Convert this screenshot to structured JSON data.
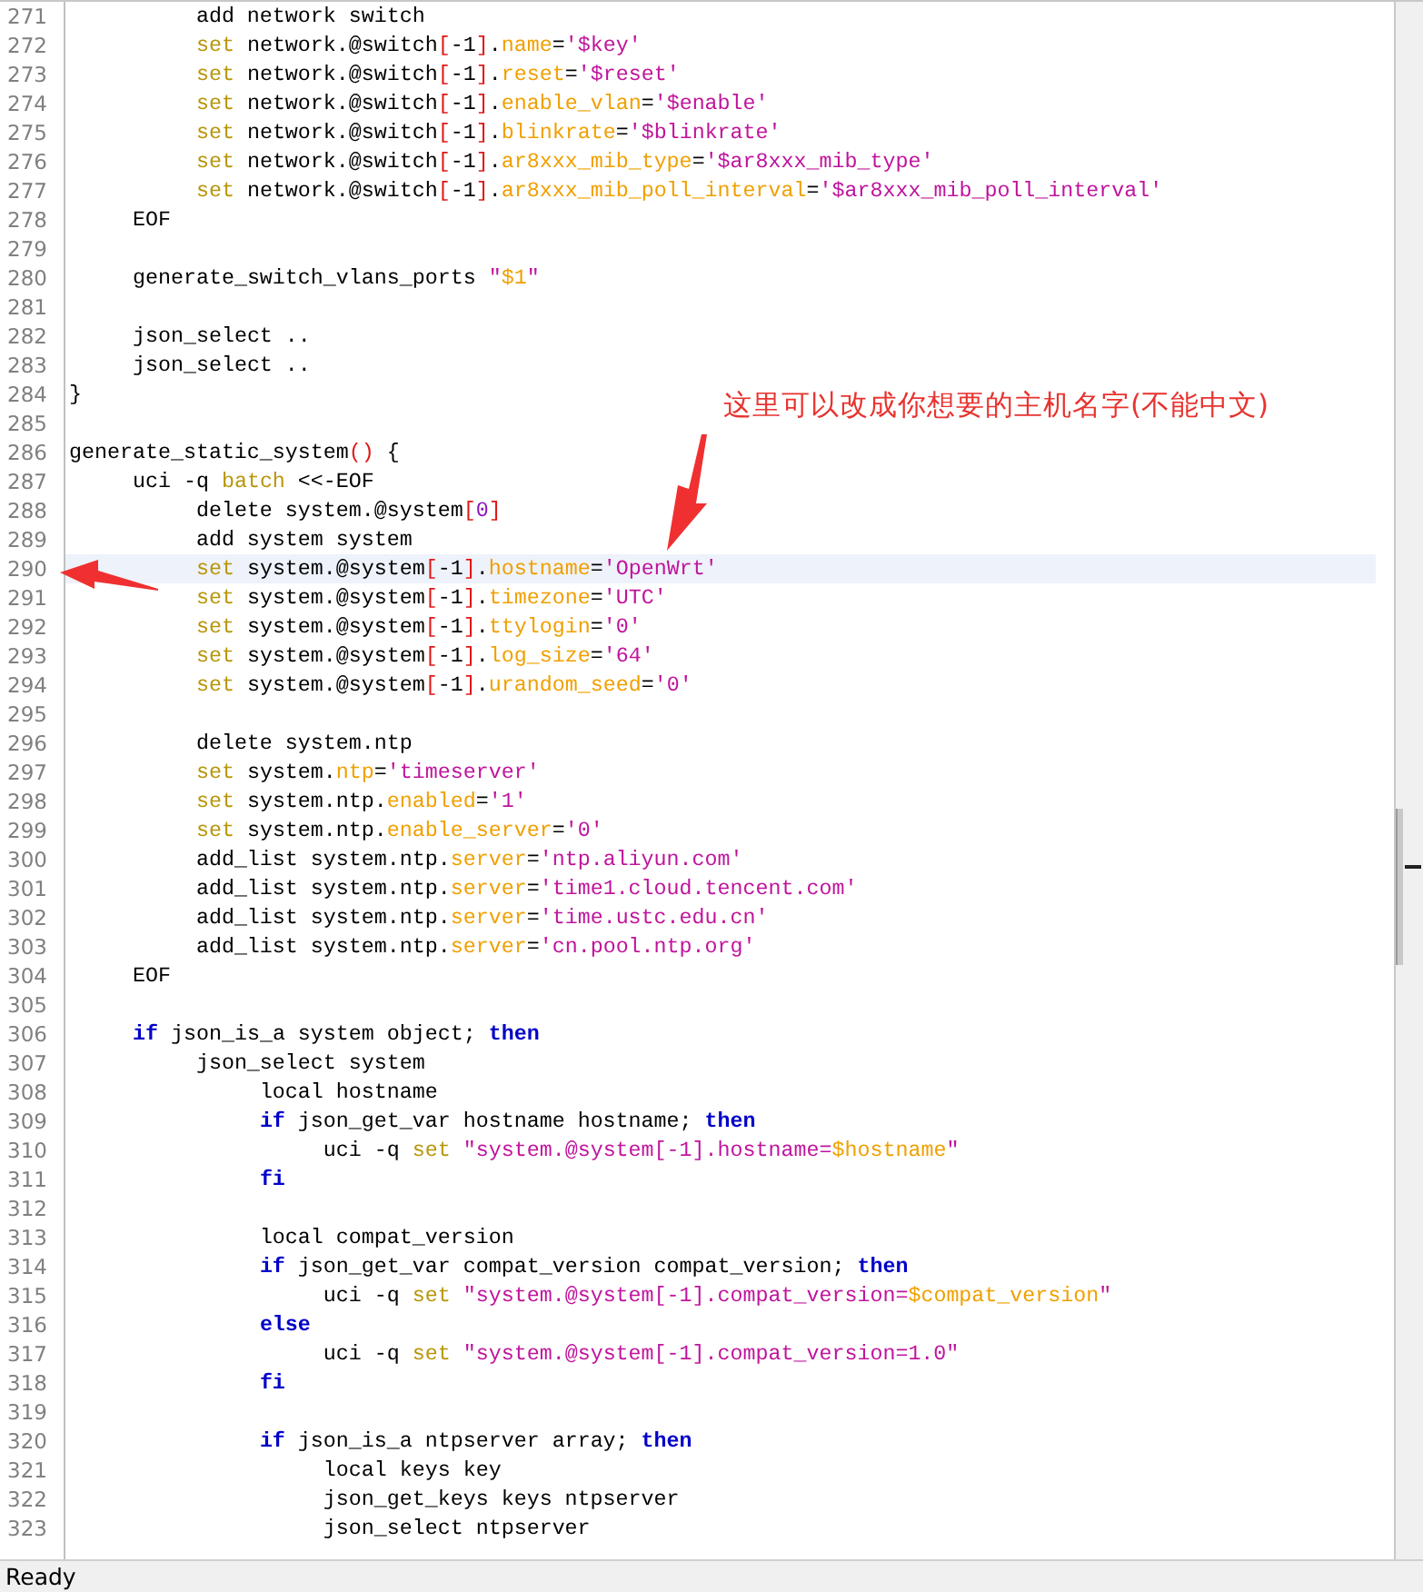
{
  "editor": {
    "lines": [
      {
        "number": "271",
        "highlighted": false,
        "tokens": [
          {
            "kind": "plain",
            "text": "\t\tadd network switch"
          }
        ]
      },
      {
        "number": "272",
        "highlighted": false,
        "tokens": [
          {
            "kind": "keyword",
            "text": "\t\tset"
          },
          {
            "kind": "plain",
            "text": " network.@switch"
          },
          {
            "kind": "bracket",
            "text": "["
          },
          {
            "kind": "plain",
            "text": "-1"
          },
          {
            "kind": "bracket",
            "text": "]"
          },
          {
            "kind": "plain",
            "text": "."
          },
          {
            "kind": "property",
            "text": "name"
          },
          {
            "kind": "plain",
            "text": "="
          },
          {
            "kind": "string",
            "text": "'$key'"
          }
        ]
      },
      {
        "number": "273",
        "highlighted": false,
        "tokens": [
          {
            "kind": "keyword",
            "text": "\t\tset"
          },
          {
            "kind": "plain",
            "text": " network.@switch"
          },
          {
            "kind": "bracket",
            "text": "["
          },
          {
            "kind": "plain",
            "text": "-1"
          },
          {
            "kind": "bracket",
            "text": "]"
          },
          {
            "kind": "plain",
            "text": "."
          },
          {
            "kind": "property",
            "text": "reset"
          },
          {
            "kind": "plain",
            "text": "="
          },
          {
            "kind": "string",
            "text": "'$reset'"
          }
        ]
      },
      {
        "number": "274",
        "highlighted": false,
        "tokens": [
          {
            "kind": "keyword",
            "text": "\t\tset"
          },
          {
            "kind": "plain",
            "text": " network.@switch"
          },
          {
            "kind": "bracket",
            "text": "["
          },
          {
            "kind": "plain",
            "text": "-1"
          },
          {
            "kind": "bracket",
            "text": "]"
          },
          {
            "kind": "plain",
            "text": "."
          },
          {
            "kind": "property",
            "text": "enable_vlan"
          },
          {
            "kind": "plain",
            "text": "="
          },
          {
            "kind": "string",
            "text": "'$enable'"
          }
        ]
      },
      {
        "number": "275",
        "highlighted": false,
        "tokens": [
          {
            "kind": "keyword",
            "text": "\t\tset"
          },
          {
            "kind": "plain",
            "text": " network.@switch"
          },
          {
            "kind": "bracket",
            "text": "["
          },
          {
            "kind": "plain",
            "text": "-1"
          },
          {
            "kind": "bracket",
            "text": "]"
          },
          {
            "kind": "plain",
            "text": "."
          },
          {
            "kind": "property",
            "text": "blinkrate"
          },
          {
            "kind": "plain",
            "text": "="
          },
          {
            "kind": "string",
            "text": "'$blinkrate'"
          }
        ]
      },
      {
        "number": "276",
        "highlighted": false,
        "tokens": [
          {
            "kind": "keyword",
            "text": "\t\tset"
          },
          {
            "kind": "plain",
            "text": " network.@switch"
          },
          {
            "kind": "bracket",
            "text": "["
          },
          {
            "kind": "plain",
            "text": "-1"
          },
          {
            "kind": "bracket",
            "text": "]"
          },
          {
            "kind": "plain",
            "text": "."
          },
          {
            "kind": "property",
            "text": "ar8xxx_mib_type"
          },
          {
            "kind": "plain",
            "text": "="
          },
          {
            "kind": "string",
            "text": "'$ar8xxx_mib_type'"
          }
        ]
      },
      {
        "number": "277",
        "highlighted": false,
        "tokens": [
          {
            "kind": "keyword",
            "text": "\t\tset"
          },
          {
            "kind": "plain",
            "text": " network.@switch"
          },
          {
            "kind": "bracket",
            "text": "["
          },
          {
            "kind": "plain",
            "text": "-1"
          },
          {
            "kind": "bracket",
            "text": "]"
          },
          {
            "kind": "plain",
            "text": "."
          },
          {
            "kind": "property",
            "text": "ar8xxx_mib_poll_interval"
          },
          {
            "kind": "plain",
            "text": "="
          },
          {
            "kind": "string",
            "text": "'$ar8xxx_mib_poll_interval'"
          }
        ]
      },
      {
        "number": "278",
        "highlighted": false,
        "tokens": [
          {
            "kind": "plain",
            "text": "\tEOF"
          }
        ]
      },
      {
        "number": "279",
        "highlighted": false
      },
      {
        "number": "280",
        "highlighted": false,
        "tokens": [
          {
            "kind": "plain",
            "text": "\tgenerate_switch_vlans_ports "
          },
          {
            "kind": "string",
            "text": "\""
          },
          {
            "kind": "variable",
            "text": "$1"
          },
          {
            "kind": "string",
            "text": "\""
          }
        ]
      },
      {
        "number": "281",
        "highlighted": false
      },
      {
        "number": "282",
        "highlighted": false,
        "tokens": [
          {
            "kind": "plain",
            "text": "\tjson_select .."
          }
        ]
      },
      {
        "number": "283",
        "highlighted": false,
        "tokens": [
          {
            "kind": "plain",
            "text": "\tjson_select .."
          }
        ]
      },
      {
        "number": "284",
        "highlighted": false,
        "tokens": [
          {
            "kind": "plain",
            "text": "}"
          }
        ]
      },
      {
        "number": "285",
        "highlighted": false
      },
      {
        "number": "286",
        "highlighted": false,
        "tokens": [
          {
            "kind": "plain",
            "text": "generate_static_system"
          },
          {
            "kind": "bracket",
            "text": "()"
          },
          {
            "kind": "plain",
            "text": " {"
          }
        ]
      },
      {
        "number": "287",
        "highlighted": false,
        "tokens": [
          {
            "kind": "plain",
            "text": "\tuci -q "
          },
          {
            "kind": "keyword",
            "text": "batch"
          },
          {
            "kind": "plain",
            "text": " <<-EOF"
          }
        ]
      },
      {
        "number": "288",
        "highlighted": false,
        "tokens": [
          {
            "kind": "plain",
            "text": "\t\tdelete system.@system"
          },
          {
            "kind": "bracket",
            "text": "["
          },
          {
            "kind": "number",
            "text": "0"
          },
          {
            "kind": "bracket",
            "text": "]"
          }
        ]
      },
      {
        "number": "289",
        "highlighted": false,
        "tokens": [
          {
            "kind": "plain",
            "text": "\t\tadd system system"
          }
        ]
      },
      {
        "number": "290",
        "highlighted": true,
        "tokens": [
          {
            "kind": "keyword",
            "text": "\t\tset"
          },
          {
            "kind": "plain",
            "text": " system.@system"
          },
          {
            "kind": "bracket",
            "text": "["
          },
          {
            "kind": "plain",
            "text": "-1"
          },
          {
            "kind": "bracket",
            "text": "]"
          },
          {
            "kind": "plain",
            "text": "."
          },
          {
            "kind": "property",
            "text": "hostname"
          },
          {
            "kind": "plain",
            "text": "="
          },
          {
            "kind": "string",
            "text": "'OpenWrt'"
          }
        ]
      },
      {
        "number": "291",
        "highlighted": false,
        "tokens": [
          {
            "kind": "keyword",
            "text": "\t\tset"
          },
          {
            "kind": "plain",
            "text": " system.@system"
          },
          {
            "kind": "bracket",
            "text": "["
          },
          {
            "kind": "plain",
            "text": "-1"
          },
          {
            "kind": "bracket",
            "text": "]"
          },
          {
            "kind": "plain",
            "text": "."
          },
          {
            "kind": "property",
            "text": "timezone"
          },
          {
            "kind": "plain",
            "text": "="
          },
          {
            "kind": "string",
            "text": "'UTC'"
          }
        ]
      },
      {
        "number": "292",
        "highlighted": false,
        "tokens": [
          {
            "kind": "keyword",
            "text": "\t\tset"
          },
          {
            "kind": "plain",
            "text": " system.@system"
          },
          {
            "kind": "bracket",
            "text": "["
          },
          {
            "kind": "plain",
            "text": "-1"
          },
          {
            "kind": "bracket",
            "text": "]"
          },
          {
            "kind": "plain",
            "text": "."
          },
          {
            "kind": "property",
            "text": "ttylogin"
          },
          {
            "kind": "plain",
            "text": "="
          },
          {
            "kind": "string",
            "text": "'0'"
          }
        ]
      },
      {
        "number": "293",
        "highlighted": false,
        "tokens": [
          {
            "kind": "keyword",
            "text": "\t\tset"
          },
          {
            "kind": "plain",
            "text": " system.@system"
          },
          {
            "kind": "bracket",
            "text": "["
          },
          {
            "kind": "plain",
            "text": "-1"
          },
          {
            "kind": "bracket",
            "text": "]"
          },
          {
            "kind": "plain",
            "text": "."
          },
          {
            "kind": "property",
            "text": "log_size"
          },
          {
            "kind": "plain",
            "text": "="
          },
          {
            "kind": "string",
            "text": "'64'"
          }
        ]
      },
      {
        "number": "294",
        "highlighted": false,
        "tokens": [
          {
            "kind": "keyword",
            "text": "\t\tset"
          },
          {
            "kind": "plain",
            "text": " system.@system"
          },
          {
            "kind": "bracket",
            "text": "["
          },
          {
            "kind": "plain",
            "text": "-1"
          },
          {
            "kind": "bracket",
            "text": "]"
          },
          {
            "kind": "plain",
            "text": "."
          },
          {
            "kind": "property",
            "text": "urandom_seed"
          },
          {
            "kind": "plain",
            "text": "="
          },
          {
            "kind": "string",
            "text": "'0'"
          }
        ]
      },
      {
        "number": "295",
        "highlighted": false
      },
      {
        "number": "296",
        "highlighted": false,
        "tokens": [
          {
            "kind": "plain",
            "text": "\t\tdelete system.ntp"
          }
        ]
      },
      {
        "number": "297",
        "highlighted": false,
        "tokens": [
          {
            "kind": "keyword",
            "text": "\t\tset"
          },
          {
            "kind": "plain",
            "text": " system."
          },
          {
            "kind": "property",
            "text": "ntp"
          },
          {
            "kind": "plain",
            "text": "="
          },
          {
            "kind": "string",
            "text": "'timeserver'"
          }
        ]
      },
      {
        "number": "298",
        "highlighted": false,
        "tokens": [
          {
            "kind": "keyword",
            "text": "\t\tset"
          },
          {
            "kind": "plain",
            "text": " system.ntp."
          },
          {
            "kind": "property",
            "text": "enabled"
          },
          {
            "kind": "plain",
            "text": "="
          },
          {
            "kind": "string",
            "text": "'1'"
          }
        ]
      },
      {
        "number": "299",
        "highlighted": false,
        "tokens": [
          {
            "kind": "keyword",
            "text": "\t\tset"
          },
          {
            "kind": "plain",
            "text": " system.ntp."
          },
          {
            "kind": "property",
            "text": "enable_server"
          },
          {
            "kind": "plain",
            "text": "="
          },
          {
            "kind": "string",
            "text": "'0'"
          }
        ]
      },
      {
        "number": "300",
        "highlighted": false,
        "tokens": [
          {
            "kind": "plain",
            "text": "\t\tadd_list system.ntp."
          },
          {
            "kind": "property",
            "text": "server"
          },
          {
            "kind": "plain",
            "text": "="
          },
          {
            "kind": "string",
            "text": "'ntp.aliyun.com'"
          }
        ]
      },
      {
        "number": "301",
        "highlighted": false,
        "tokens": [
          {
            "kind": "plain",
            "text": "\t\tadd_list system.ntp."
          },
          {
            "kind": "property",
            "text": "server"
          },
          {
            "kind": "plain",
            "text": "="
          },
          {
            "kind": "string",
            "text": "'time1.cloud.tencent.com'"
          }
        ]
      },
      {
        "number": "302",
        "highlighted": false,
        "tokens": [
          {
            "kind": "plain",
            "text": "\t\tadd_list system.ntp."
          },
          {
            "kind": "property",
            "text": "server"
          },
          {
            "kind": "plain",
            "text": "="
          },
          {
            "kind": "string",
            "text": "'time.ustc.edu.cn'"
          }
        ]
      },
      {
        "number": "303",
        "highlighted": false,
        "tokens": [
          {
            "kind": "plain",
            "text": "\t\tadd_list system.ntp."
          },
          {
            "kind": "property",
            "text": "server"
          },
          {
            "kind": "plain",
            "text": "="
          },
          {
            "kind": "string",
            "text": "'cn.pool.ntp.org'"
          }
        ]
      },
      {
        "number": "304",
        "highlighted": false,
        "tokens": [
          {
            "kind": "plain",
            "text": "\tEOF"
          }
        ]
      },
      {
        "number": "305",
        "highlighted": false
      },
      {
        "number": "306",
        "highlighted": false,
        "tokens": [
          {
            "kind": "control",
            "text": "\tif"
          },
          {
            "kind": "plain",
            "text": " json_is_a system object; "
          },
          {
            "kind": "control",
            "text": "then"
          }
        ]
      },
      {
        "number": "307",
        "highlighted": false,
        "tokens": [
          {
            "kind": "plain",
            "text": "\t\tjson_select system"
          }
        ]
      },
      {
        "number": "308",
        "highlighted": false,
        "tokens": [
          {
            "kind": "plain",
            "text": "\t\t\tlocal hostname"
          }
        ]
      },
      {
        "number": "309",
        "highlighted": false,
        "tokens": [
          {
            "kind": "control",
            "text": "\t\t\tif"
          },
          {
            "kind": "plain",
            "text": " json_get_var hostname hostname; "
          },
          {
            "kind": "control",
            "text": "then"
          }
        ]
      },
      {
        "number": "310",
        "highlighted": false,
        "tokens": [
          {
            "kind": "plain",
            "text": "\t\t\t\tuci -q "
          },
          {
            "kind": "keyword",
            "text": "set"
          },
          {
            "kind": "string",
            "text": " \"system.@system[-1].hostname="
          },
          {
            "kind": "variable",
            "text": "$hostname"
          },
          {
            "kind": "string",
            "text": "\""
          }
        ]
      },
      {
        "number": "311",
        "highlighted": false,
        "tokens": [
          {
            "kind": "control",
            "text": "\t\t\tfi"
          }
        ]
      },
      {
        "number": "312",
        "highlighted": false
      },
      {
        "number": "313",
        "highlighted": false,
        "tokens": [
          {
            "kind": "plain",
            "text": "\t\t\tlocal compat_version"
          }
        ]
      },
      {
        "number": "314",
        "highlighted": false,
        "tokens": [
          {
            "kind": "control",
            "text": "\t\t\tif"
          },
          {
            "kind": "plain",
            "text": " json_get_var compat_version compat_version; "
          },
          {
            "kind": "control",
            "text": "then"
          }
        ]
      },
      {
        "number": "315",
        "highlighted": false,
        "tokens": [
          {
            "kind": "plain",
            "text": "\t\t\t\tuci -q "
          },
          {
            "kind": "keyword",
            "text": "set"
          },
          {
            "kind": "string",
            "text": " \"system.@system[-1].compat_version="
          },
          {
            "kind": "variable",
            "text": "$compat_version"
          },
          {
            "kind": "string",
            "text": "\""
          }
        ]
      },
      {
        "number": "316",
        "highlighted": false,
        "tokens": [
          {
            "kind": "control",
            "text": "\t\t\telse"
          }
        ]
      },
      {
        "number": "317",
        "highlighted": false,
        "tokens": [
          {
            "kind": "plain",
            "text": "\t\t\t\tuci -q "
          },
          {
            "kind": "keyword",
            "text": "set"
          },
          {
            "kind": "string",
            "text": " \"system.@system[-1].compat_version=1.0\""
          }
        ]
      },
      {
        "number": "318",
        "highlighted": false,
        "tokens": [
          {
            "kind": "control",
            "text": "\t\t\tfi"
          }
        ]
      },
      {
        "number": "319",
        "highlighted": false
      },
      {
        "number": "320",
        "highlighted": false,
        "tokens": [
          {
            "kind": "control",
            "text": "\t\t\tif"
          },
          {
            "kind": "plain",
            "text": " json_is_a ntpserver array; "
          },
          {
            "kind": "control",
            "text": "then"
          }
        ]
      },
      {
        "number": "321",
        "highlighted": false,
        "tokens": [
          {
            "kind": "plain",
            "text": "\t\t\t\tlocal keys key"
          }
        ]
      },
      {
        "number": "322",
        "highlighted": false,
        "tokens": [
          {
            "kind": "plain",
            "text": "\t\t\t\tjson_get_keys keys ntpserver"
          }
        ]
      },
      {
        "number": "323",
        "highlighted": false,
        "tokens": [
          {
            "kind": "plain",
            "text": "\t\t\t\tjson_select ntpserver"
          }
        ]
      }
    ]
  },
  "annotation": {
    "text": "这里可以改成你想要的主机名字(不能中文)"
  },
  "status_bar": {
    "text": "Ready"
  }
}
